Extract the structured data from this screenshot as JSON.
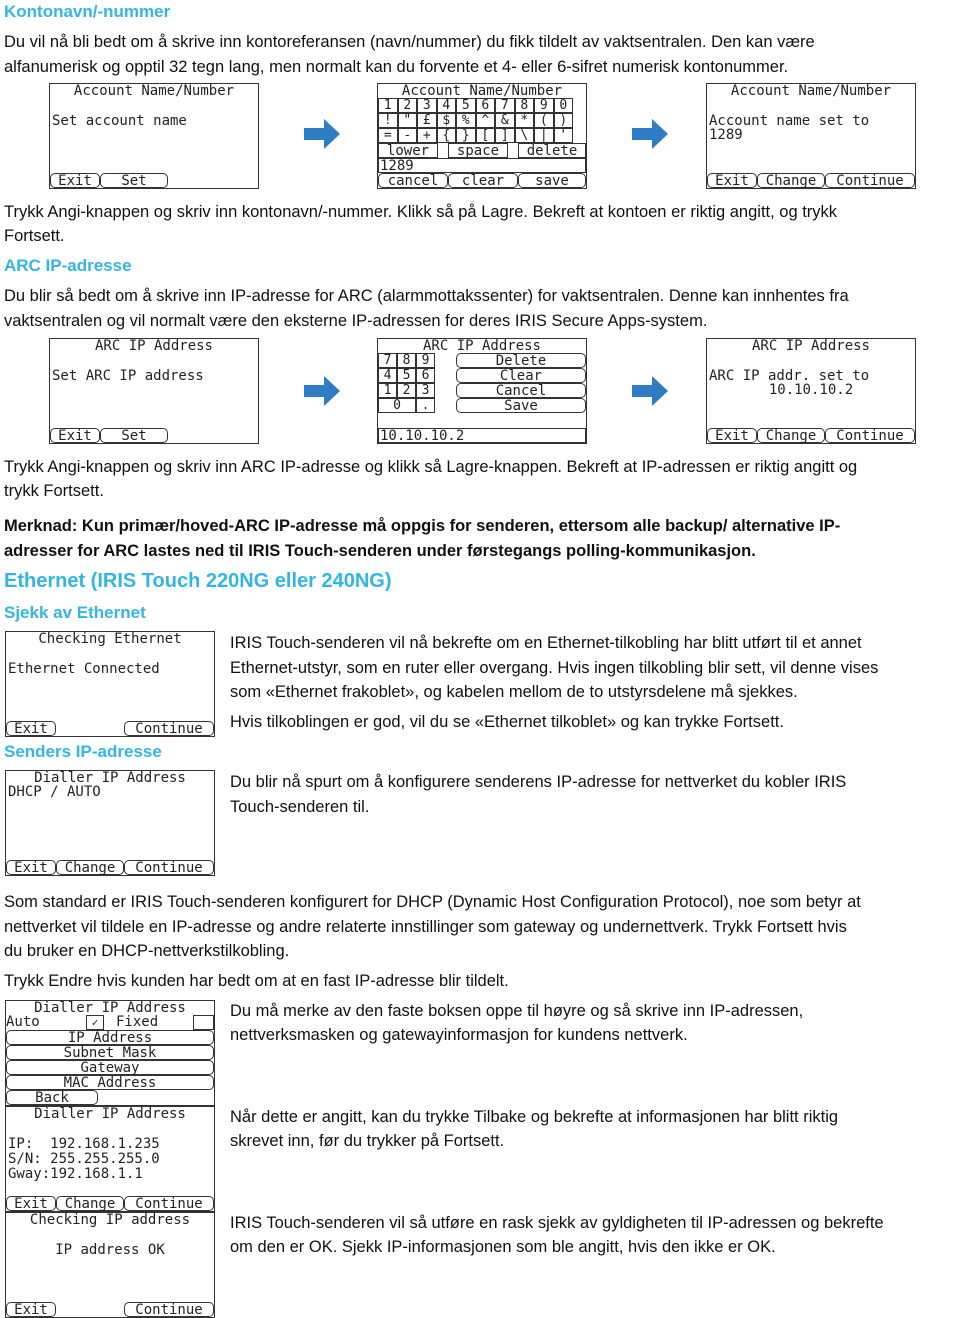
{
  "sections": {
    "account": {
      "heading": "Kontonavn/-nummer",
      "intro": [
        "Du vil nå bli bedt om å skrive inn kontoreferansen (navn/nummer) du fikk tildelt av vaktsentralen. Den kan være",
        "alfanumerisk og opptil 32 tegn lang, men normalt kan du forvente et 4- eller 6-sifret numerisk kontonummer."
      ],
      "instructions": [
        "Trykk Angi-knappen og skriv inn kontonavn/-nummer. Klikk så på Lagre. Bekreft at kontoen er riktig angitt, og trykk",
        "Fortsett."
      ],
      "screen1": {
        "title": "Account Name/Number",
        "line": "Set account name",
        "buttons": [
          "Exit",
          "Set"
        ]
      },
      "keyboard": {
        "title": "Account Name/Number",
        "row1": [
          "1",
          "2",
          "3",
          "4",
          "5",
          "6",
          "7",
          "8",
          "9",
          "0"
        ],
        "row2": [
          "!",
          "\"",
          "£",
          "$",
          "%",
          "^",
          "&",
          "*",
          "(",
          ")"
        ],
        "row3": [
          "=",
          "-",
          "+",
          "{",
          "}",
          "[",
          "]",
          "\\",
          "|",
          "'"
        ],
        "row4": [
          "lower",
          "space",
          "delete"
        ],
        "input": "1289",
        "buttons": [
          "cancel",
          "clear",
          "save"
        ]
      },
      "screen3": {
        "title": "Account Name/Number",
        "line1": "Account name set to",
        "line2": "1289",
        "buttons": [
          "Exit",
          "Change",
          "Continue"
        ]
      }
    },
    "arc": {
      "heading": "ARC IP-adresse",
      "intro": [
        "Du blir så bedt om å skrive inn IP-adresse for ARC (alarmmottakssenter) for vaktsentralen. Denne kan innhentes fra",
        "vaktsentralen og vil normalt være den eksterne IP-adressen for deres IRIS Secure Apps-system."
      ],
      "instructions": [
        "Trykk Angi-knappen og skriv inn ARC IP-adresse og klikk så Lagre-knappen. Bekreft at IP-adressen er riktig angitt og",
        "trykk Fortsett."
      ],
      "note": [
        "Merknad: Kun primær/hoved-ARC IP-adresse må oppgis for senderen, ettersom alle backup/ alternative IP-",
        "adresser for ARC lastes ned til IRIS Touch-senderen under førstegangs polling-kommunikasjon."
      ],
      "screen1": {
        "title": "ARC IP Address",
        "line": "Set ARC IP address",
        "buttons": [
          "Exit",
          "Set"
        ]
      },
      "keypad": {
        "title": "ARC IP Address",
        "keys": [
          "7",
          "8",
          "9",
          "4",
          "5",
          "6",
          "1",
          "2",
          "3",
          "0",
          "."
        ],
        "actions": [
          "Delete",
          "Clear",
          "Cancel",
          "Save"
        ],
        "input": "10.10.10.2"
      },
      "screen3": {
        "title": "ARC IP Address",
        "line1": "ARC IP addr. set to",
        "line2": "10.10.10.2",
        "buttons": [
          "Exit",
          "Change",
          "Continue"
        ]
      }
    },
    "ethernet": {
      "heading": "Ethernet (IRIS Touch 220NG eller 240NG)",
      "subheading": "Sjekk av Ethernet",
      "text1": [
        "IRIS Touch-senderen vil nå bekrefte om en Ethernet-tilkobling har blitt utført til et annet",
        "Ethernet-utstyr, som en ruter eller overgang. Hvis ingen tilkobling blir sett, vil denne vises",
        "som «Ethernet frakoblet», og kabelen mellom de to utstyrsdelene må sjekkes."
      ],
      "text2": "Hvis tilkoblingen er god, vil du se «Ethernet tilkoblet» og kan trykke Fortsett.",
      "screen": {
        "title": "Checking Ethernet",
        "line": "Ethernet Connected",
        "buttons": [
          "Exit",
          "Continue"
        ]
      }
    },
    "sender_ip": {
      "heading": "Senders IP-adresse",
      "text": [
        "Du blir nå spurt om å konfigurere senderens IP-adresse for nettverket du kobler IRIS",
        "Touch-senderen til."
      ],
      "screen": {
        "title": "Dialler IP Address",
        "line": "DHCP / AUTO",
        "buttons": [
          "Exit",
          "Change",
          "Continue"
        ]
      },
      "dhcp_text": [
        "Som standard er IRIS Touch-senderen konfigurert for DHCP (Dynamic Host Configuration Protocol), noe som betyr at",
        "nettverket vil tildele en IP-adresse og andre relaterte innstillinger som gateway og undernettverk. Trykk Fortsett hvis",
        "du bruker en DHCP-nettverkstilkobling."
      ],
      "change_text": "Trykk Endre hvis kunden har bedt om at en fast IP-adresse blir tildelt.",
      "fixed_text": [
        "Du må merke av den faste boksen oppe til høyre og så skrive inn IP-adressen,",
        "nettverksmasken og gatewayinformasjon for kundens nettverk."
      ],
      "back_text": [
        "Når dette er angitt, kan du trykke Tilbake og bekrefte at informasjonen har blitt riktig",
        "skrevet inn, før du trykker på Fortsett."
      ],
      "check_text": [
        "IRIS Touch-senderen vil så utføre en rask sjekk av gyldigheten til IP-adressen og bekrefte",
        "om den er OK. Sjekk IP-informasjonen som ble angitt, hvis den ikke er OK."
      ],
      "fixed_screen": {
        "title": "Dialler IP Address",
        "auto": "Auto",
        "auto_checked": true,
        "check": "✓",
        "fixed": "Fixed",
        "fixed_checked": false,
        "buttons": [
          "IP Address",
          "Subnet Mask",
          "Gateway",
          "MAC Address"
        ],
        "back": "Back"
      },
      "result_screen": {
        "title": "Dialler IP Address",
        "lines": [
          "IP:  192.168.1.235",
          "S/N: 255.255.255.0",
          "Gway:192.168.1.1"
        ],
        "buttons": [
          "Exit",
          "Change",
          "Continue"
        ]
      },
      "check_screen": {
        "title": "Checking IP address",
        "line": "IP address OK",
        "buttons": [
          "Exit",
          "Continue"
        ]
      }
    }
  },
  "colors": {
    "heading": "#33b5e5",
    "arrow": "#2e7cc4"
  },
  "icons": {
    "arrow": "arrow-right-icon"
  }
}
